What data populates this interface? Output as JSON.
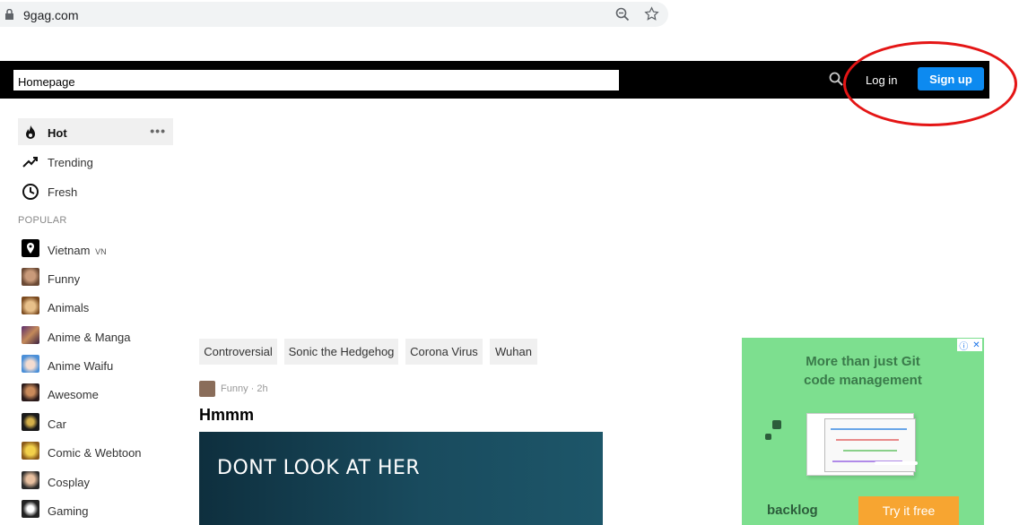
{
  "browser": {
    "url": "9gag.com"
  },
  "header": {
    "search_value": "Homepage",
    "login_label": "Log in",
    "signup_label": "Sign up"
  },
  "sidebar": {
    "nav": [
      {
        "label": "Hot"
      },
      {
        "label": "Trending"
      },
      {
        "label": "Fresh"
      }
    ],
    "popular_heading": "POPULAR",
    "popular": [
      {
        "label": "Vietnam",
        "suffix": "VN"
      },
      {
        "label": "Funny"
      },
      {
        "label": "Animals"
      },
      {
        "label": "Anime & Manga"
      },
      {
        "label": "Anime Waifu"
      },
      {
        "label": "Awesome"
      },
      {
        "label": "Car"
      },
      {
        "label": "Comic & Webtoon"
      },
      {
        "label": "Cosplay"
      },
      {
        "label": "Gaming"
      }
    ]
  },
  "tags": [
    "Controversial",
    "Sonic the Hedgehog",
    "Corona Virus",
    "Wuhan"
  ],
  "post": {
    "meta": "Funny · 2h",
    "title": "Hmmm",
    "image_text": "DONT LOOK AT HER"
  },
  "ad": {
    "line1": "More than just Git",
    "line2": "code management",
    "brand": "backlog",
    "cta": "Try it free"
  },
  "colors": {
    "accent": "#0d8af0",
    "annotation": "#e41515",
    "ad_bg": "#7ddf8f"
  }
}
